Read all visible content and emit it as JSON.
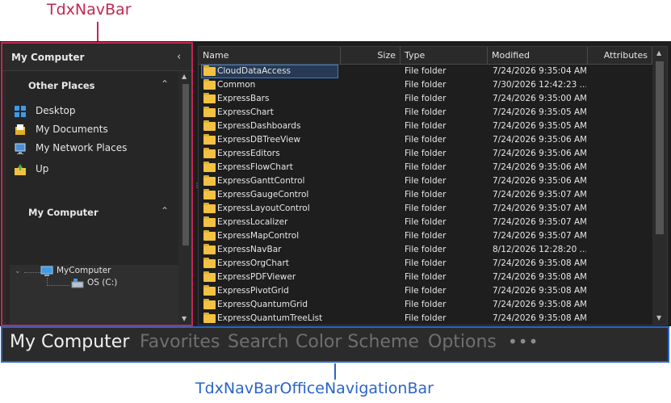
{
  "callouts": {
    "top": "TdxNavBar",
    "bottom": "TdxNavBarOfficeNavigationBar"
  },
  "navbar": {
    "header_title": "My Computer",
    "groups": [
      {
        "title": "Other Places",
        "items": [
          {
            "label": "Desktop",
            "icon": "desktop-icon"
          },
          {
            "label": "My Documents",
            "icon": "documents-icon"
          },
          {
            "label": "My Network Places",
            "icon": "network-icon"
          },
          {
            "label": "Up",
            "icon": "up-folder-icon"
          }
        ]
      },
      {
        "title": "My Computer",
        "tree": [
          {
            "label": "MyComputer",
            "icon": "computer-icon"
          },
          {
            "label": "OS (C:)",
            "icon": "drive-icon"
          }
        ]
      }
    ]
  },
  "filelist": {
    "columns": [
      "Name",
      "Size",
      "Type",
      "Modified",
      "Attributes"
    ],
    "rows": [
      {
        "name": "CloudDataAccess",
        "size": "",
        "type": "File folder",
        "modified": "7/24/2026 9:35:04 AM",
        "selected": true
      },
      {
        "name": "Common",
        "size": "",
        "type": "File folder",
        "modified": "7/30/2026 12:42:23 ..."
      },
      {
        "name": "ExpressBars",
        "size": "",
        "type": "File folder",
        "modified": "7/24/2026 9:35:00 AM"
      },
      {
        "name": "ExpressChart",
        "size": "",
        "type": "File folder",
        "modified": "7/24/2026 9:35:05 AM"
      },
      {
        "name": "ExpressDashboards",
        "size": "",
        "type": "File folder",
        "modified": "7/24/2026 9:35:05 AM"
      },
      {
        "name": "ExpressDBTreeView",
        "size": "",
        "type": "File folder",
        "modified": "7/24/2026 9:35:06 AM"
      },
      {
        "name": "ExpressEditors",
        "size": "",
        "type": "File folder",
        "modified": "7/24/2026 9:35:06 AM"
      },
      {
        "name": "ExpressFlowChart",
        "size": "",
        "type": "File folder",
        "modified": "7/24/2026 9:35:06 AM"
      },
      {
        "name": "ExpressGanttControl",
        "size": "",
        "type": "File folder",
        "modified": "7/24/2026 9:35:06 AM"
      },
      {
        "name": "ExpressGaugeControl",
        "size": "",
        "type": "File folder",
        "modified": "7/24/2026 9:35:07 AM"
      },
      {
        "name": "ExpressLayoutControl",
        "size": "",
        "type": "File folder",
        "modified": "7/24/2026 9:35:07 AM"
      },
      {
        "name": "ExpressLocalizer",
        "size": "",
        "type": "File folder",
        "modified": "7/24/2026 9:35:07 AM"
      },
      {
        "name": "ExpressMapControl",
        "size": "",
        "type": "File folder",
        "modified": "7/24/2026 9:35:07 AM"
      },
      {
        "name": "ExpressNavBar",
        "size": "",
        "type": "File folder",
        "modified": "8/12/2026 12:28:20 ..."
      },
      {
        "name": "ExpressOrgChart",
        "size": "",
        "type": "File folder",
        "modified": "7/24/2026 9:35:08 AM"
      },
      {
        "name": "ExpressPDFViewer",
        "size": "",
        "type": "File folder",
        "modified": "7/24/2026 9:35:08 AM"
      },
      {
        "name": "ExpressPivotGrid",
        "size": "",
        "type": "File folder",
        "modified": "7/24/2026 9:35:08 AM"
      },
      {
        "name": "ExpressQuantumGrid",
        "size": "",
        "type": "File folder",
        "modified": "7/24/2026 9:35:08 AM"
      },
      {
        "name": "ExpressQuantumTreeList",
        "size": "",
        "type": "File folder",
        "modified": "7/24/2026 9:35:08 AM"
      }
    ]
  },
  "office_nav": {
    "items": [
      "My Computer",
      "Favorites",
      "Search",
      "Color Scheme",
      "Options"
    ],
    "active": "My Computer",
    "more": "•••"
  },
  "colors": {
    "navbar_border": "#c2284f",
    "office_nav_border": "#2a64c8",
    "folder": "#f4c242"
  }
}
